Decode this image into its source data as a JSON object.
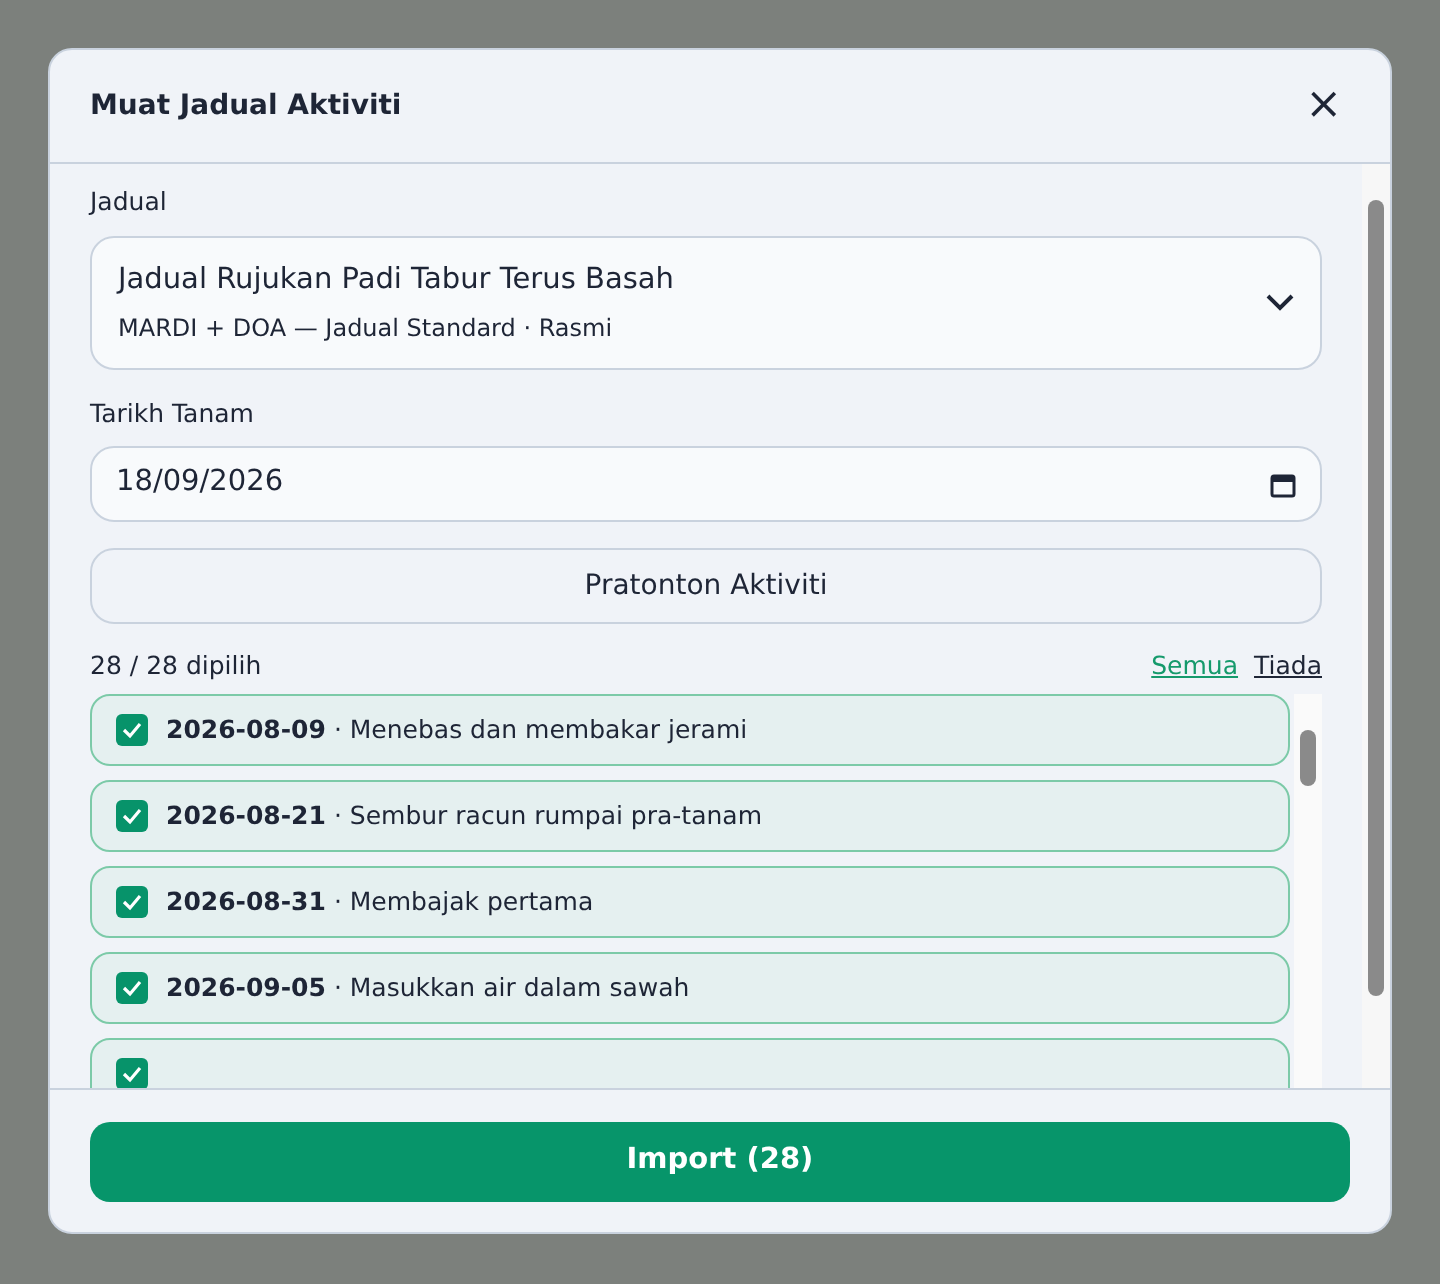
{
  "dialog": {
    "title": "Muat Jadual Aktiviti",
    "close": "×"
  },
  "schedule": {
    "label": "Jadual",
    "value": "Jadual Rujukan Padi Tabur Terus Basah",
    "subtitle": "MARDI + DOA — Jadual Standard · Rasmi"
  },
  "plant_date": {
    "label": "Tarikh Tanam",
    "value": "18/09/2026"
  },
  "preview_button": "Pratonton Aktiviti",
  "selection": {
    "count": "28 / 28 dipilih",
    "links": [
      "Semua",
      "Tiada"
    ]
  },
  "activities": [
    {
      "text": "**2026-08-09** · Menebas dan membakar jerami",
      "checked": true
    },
    {
      "text": "**2026-08-21** · Sembur racun rumpai pra-tanam",
      "checked": true
    },
    {
      "text": "**2026-08-31** · Membajak pertama",
      "checked": true
    },
    {
      "text": "**2026-09-05** · Masukkan air dalam sawah",
      "checked": true
    },
    {
      "checked": true
    }
  ],
  "import_button": "Import (28)"
}
